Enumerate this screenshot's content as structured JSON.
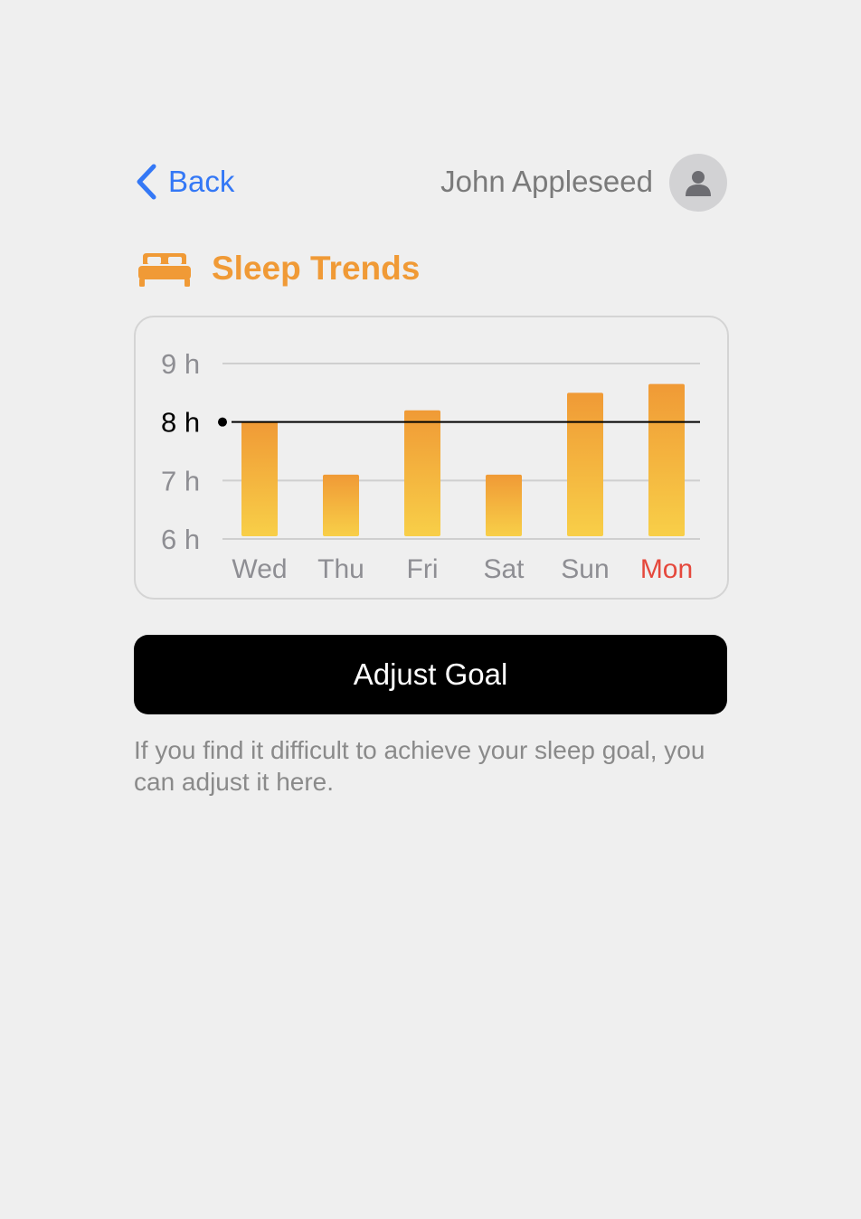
{
  "nav": {
    "back_label": "Back",
    "user_name": "John Appleseed"
  },
  "icons": {
    "back": "chevron-left-icon",
    "avatar": "person-icon",
    "section": "bed-icon"
  },
  "section": {
    "title": "Sleep Trends"
  },
  "colors": {
    "accent": "#f09a36",
    "bar_top": "#f09a36",
    "bar_bottom": "#f8cf48",
    "highlight_day": "#e5483c",
    "link": "#3478f6",
    "goal_line": "#000000"
  },
  "chart_data": {
    "type": "bar",
    "categories": [
      "Wed",
      "Thu",
      "Fri",
      "Sat",
      "Sun",
      "Mon"
    ],
    "values": [
      8.0,
      7.1,
      8.2,
      7.1,
      8.5,
      8.65
    ],
    "ylim": [
      6,
      9
    ],
    "yticks": [
      6,
      7,
      8,
      9
    ],
    "ytick_labels": [
      "6 h",
      "7 h",
      "8 h",
      "9 h"
    ],
    "goal": 8,
    "highlight_category": "Mon",
    "grid": true,
    "title": "",
    "xlabel": "",
    "ylabel": ""
  },
  "actions": {
    "adjust_goal_label": "Adjust Goal"
  },
  "hint": {
    "text": "If you find it difficult to achieve your sleep goal, you can adjust it here."
  }
}
